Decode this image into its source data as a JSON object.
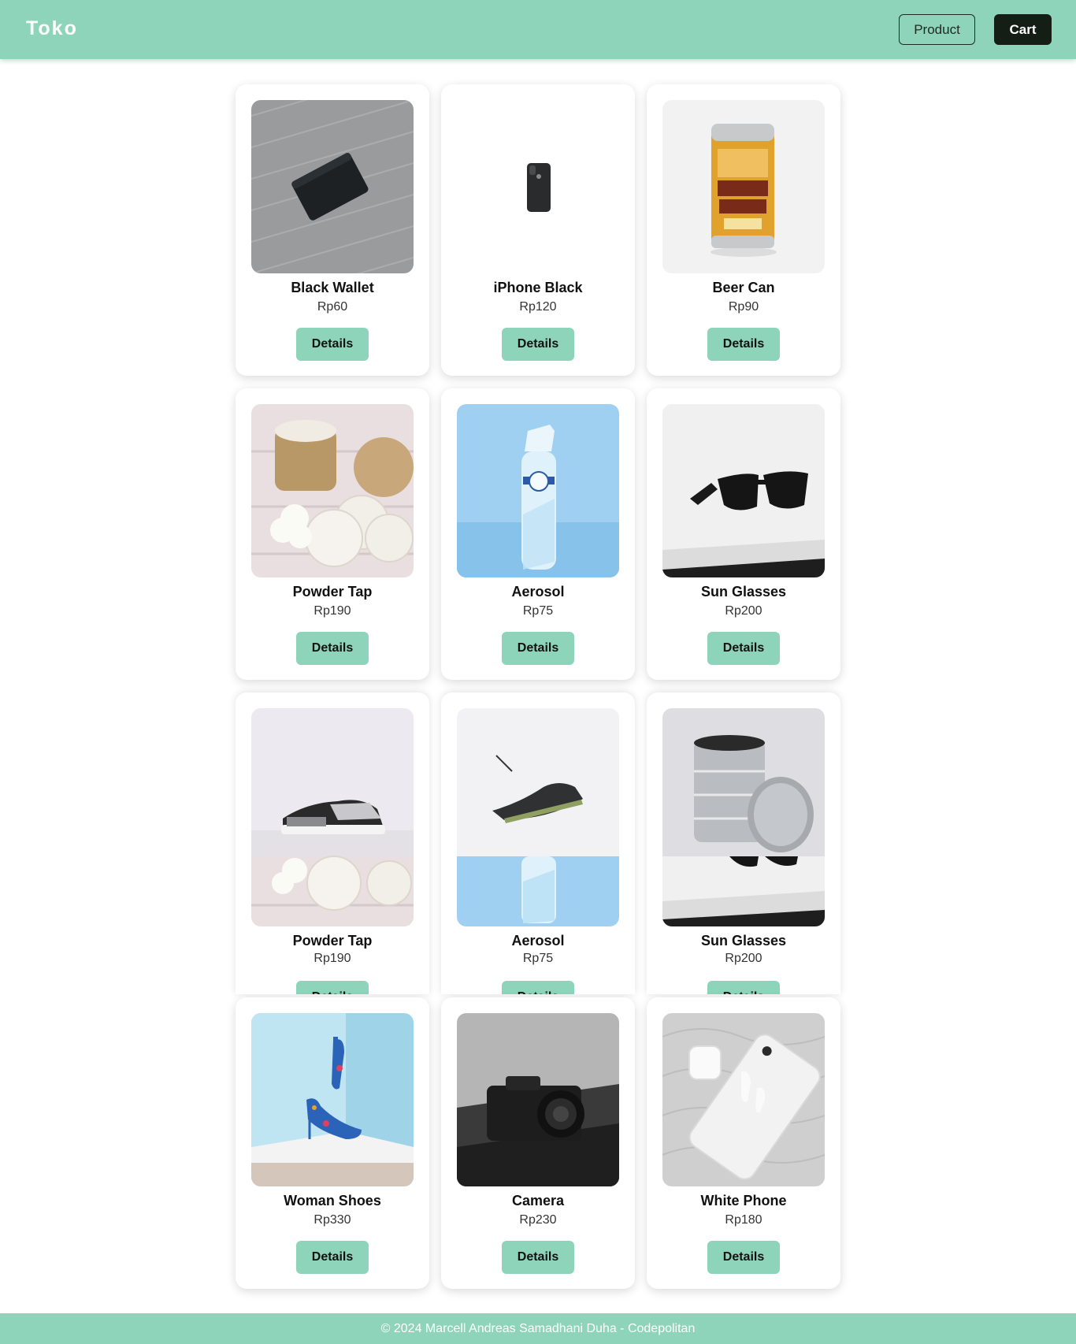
{
  "navbar": {
    "brand": "Toko",
    "product_label": "Product",
    "cart_label": "Cart",
    "color": "#8dd4bb"
  },
  "products": [
    {
      "name": "Black Wallet",
      "price": "Rp60",
      "details_label": "Details"
    },
    {
      "name": "iPhone Black",
      "price": "Rp120",
      "details_label": "Details"
    },
    {
      "name": "Beer Can",
      "price": "Rp90",
      "details_label": "Details"
    },
    {
      "name": "Powder Tap",
      "price": "Rp190",
      "details_label": "Details"
    },
    {
      "name": "Aerosol",
      "price": "Rp75",
      "details_label": "Details"
    },
    {
      "name": "Sun Glasses",
      "price": "Rp200",
      "details_label": "Details"
    },
    {
      "name": "Powder Tap",
      "price": "Rp190",
      "details_label": "Details"
    },
    {
      "name": "Aerosol",
      "price": "Rp75",
      "details_label": "Details"
    },
    {
      "name": "Sun Glasses",
      "price": "Rp200",
      "details_label": "Details"
    },
    {
      "name": "Woman Shoes",
      "price": "Rp330",
      "details_label": "Details"
    },
    {
      "name": "Camera",
      "price": "Rp230",
      "details_label": "Details"
    },
    {
      "name": "White Phone",
      "price": "Rp180",
      "details_label": "Details"
    }
  ],
  "footer": {
    "text": "© 2024 Marcell Andreas Samadhani Duha - Codepolitan"
  }
}
